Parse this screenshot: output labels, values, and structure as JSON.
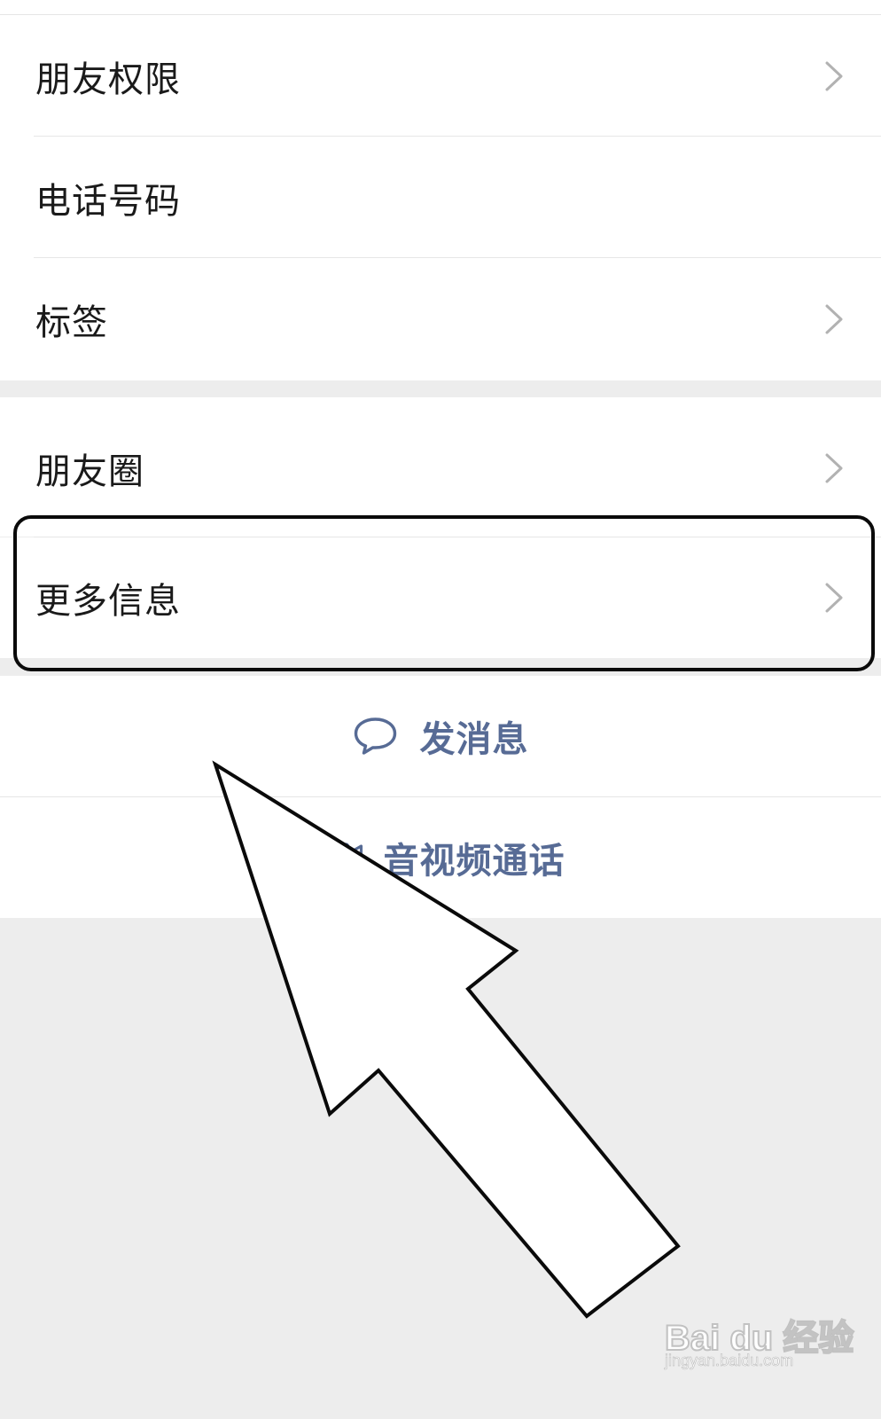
{
  "profile_menu": {
    "rows": [
      {
        "label": "朋友权限",
        "chevron": true
      },
      {
        "label": "电话号码",
        "chevron": false
      },
      {
        "label": "标签",
        "chevron": true
      }
    ],
    "moments": {
      "label": "朋友圈",
      "chevron": true
    },
    "more_info": {
      "label": "更多信息",
      "chevron": true
    }
  },
  "actions": {
    "send_message": {
      "label": "发消息",
      "icon": "chat-bubble-icon"
    },
    "av_call": {
      "label": "音视频通话",
      "icon": "video-camera-icon"
    }
  },
  "watermark": {
    "brand": "Bai du 经验",
    "url": "jingyan.baidu.com"
  },
  "colors": {
    "background": "#ededed",
    "row_background": "#ffffff",
    "text": "#1a1a1a",
    "link": "#576b95",
    "chevron": "#b2b2b2",
    "annotation": "#0a0a0a"
  }
}
